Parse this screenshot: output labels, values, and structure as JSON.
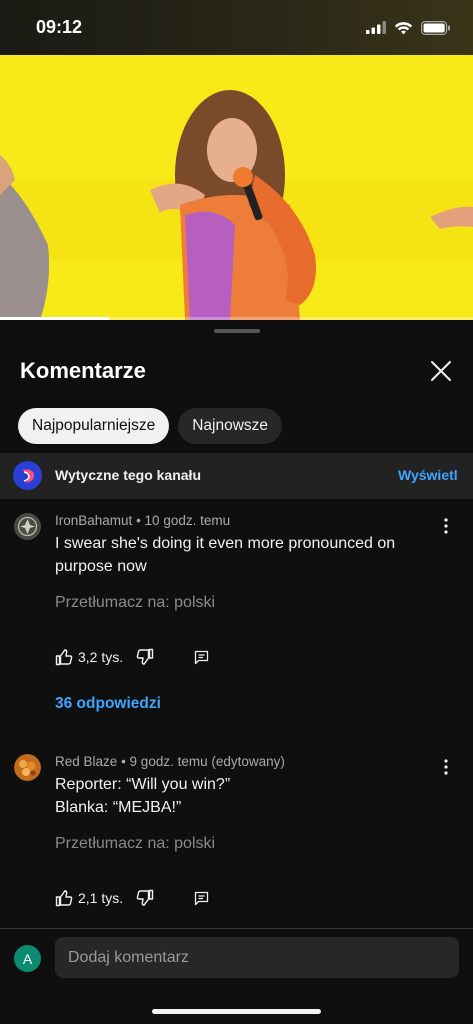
{
  "status_bar": {
    "time": "09:12"
  },
  "video": {
    "progress": 0.23
  },
  "comments_sheet": {
    "title": "Komentarze",
    "filters": [
      {
        "label": "Najpopularniejsze",
        "selected": true
      },
      {
        "label": "Najnowsze",
        "selected": false
      }
    ],
    "guidelines": {
      "text": "Wytyczne tego kanału",
      "link": "Wyświetl"
    },
    "comments": [
      {
        "author": "IronBahamut",
        "time": "10 godz. temu",
        "text": "I swear she's doing it even more pronounced on purpose now",
        "translate": "Przetłumacz na: polski",
        "likes": "3,2 tys.",
        "replies": "36 odpowiedzi"
      },
      {
        "author": "Red Blaze",
        "time": "9 godz. temu (edytowany)",
        "text_lines": [
          "Reporter: “Will you win?”",
          "Blanka: “MEJBA!”"
        ],
        "translate": "Przetłumacz na: polski",
        "likes": "2,1 tys."
      }
    ],
    "composer": {
      "avatar_letter": "A",
      "placeholder": "Dodaj komentarz"
    }
  },
  "colors": {
    "accent_link": "#3ea6ff",
    "background": "#0f0f0f",
    "video_bg": "#f7ea1f"
  }
}
